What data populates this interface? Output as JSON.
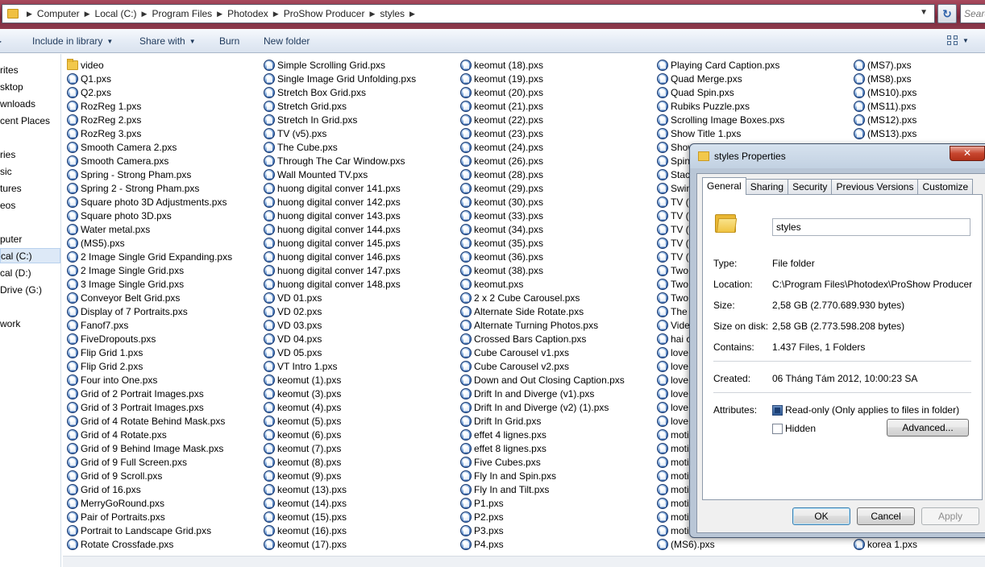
{
  "address": {
    "crumbs": [
      "Computer",
      "Local (C:)",
      "Program Files",
      "Photodex",
      "ProShow Producer",
      "styles"
    ],
    "search_placeholder": "Search styles"
  },
  "toolbar": {
    "include_label": "Include in library",
    "share_label": "Share with",
    "burn_label": "Burn",
    "new_folder_label": "New folder"
  },
  "nav": {
    "items": [
      "rites",
      "sktop",
      "wnloads",
      "cent Places",
      "ries",
      "sic",
      "tures",
      "eos",
      "puter",
      "cal (C:)",
      "cal (D:)",
      " Drive (G:)",
      "work"
    ],
    "selected_index": 9
  },
  "files": {
    "col1": [
      {
        "name": "video",
        "icon": "folder-icon"
      },
      {
        "name": "Q1.pxs",
        "icon": "pxs-icon"
      },
      {
        "name": "Q2.pxs",
        "icon": "pxs-icon"
      },
      {
        "name": "RozReg 1.pxs",
        "icon": "pxs-icon"
      },
      {
        "name": "RozReg 2.pxs",
        "icon": "pxs-icon"
      },
      {
        "name": "RozReg 3.pxs",
        "icon": "pxs-icon"
      },
      {
        "name": "Smooth Camera 2.pxs",
        "icon": "pxs-icon"
      },
      {
        "name": "Smooth Camera.pxs",
        "icon": "pxs-icon"
      },
      {
        "name": "Spring - Strong Pham.pxs",
        "icon": "pxs-icon"
      },
      {
        "name": "Spring 2 - Strong Pham.pxs",
        "icon": "pxs-icon"
      },
      {
        "name": "Square photo 3D Adjustments.pxs",
        "icon": "pxs-icon"
      },
      {
        "name": "Square photo 3D.pxs",
        "icon": "pxs-icon"
      },
      {
        "name": "Water metal.pxs",
        "icon": "pxs-icon"
      },
      {
        "name": "(MS5).pxs",
        "icon": "pxs-icon"
      },
      {
        "name": "2 Image Single Grid Expanding.pxs",
        "icon": "pxs-icon"
      },
      {
        "name": "2 Image Single Grid.pxs",
        "icon": "pxs-icon"
      },
      {
        "name": "3 Image Single Grid.pxs",
        "icon": "pxs-icon"
      },
      {
        "name": "Conveyor Belt Grid.pxs",
        "icon": "pxs-icon"
      },
      {
        "name": "Display of 7 Portraits.pxs",
        "icon": "pxs-icon"
      },
      {
        "name": "Fanof7.pxs",
        "icon": "pxs-icon"
      },
      {
        "name": "FiveDropouts.pxs",
        "icon": "pxs-icon"
      },
      {
        "name": "Flip Grid 1.pxs",
        "icon": "pxs-icon"
      },
      {
        "name": "Flip Grid 2.pxs",
        "icon": "pxs-icon"
      },
      {
        "name": "Four into One.pxs",
        "icon": "pxs-icon"
      },
      {
        "name": "Grid of 2 Portrait Images.pxs",
        "icon": "pxs-icon"
      },
      {
        "name": "Grid of 3 Portrait Images.pxs",
        "icon": "pxs-icon"
      },
      {
        "name": "Grid of 4 Rotate Behind Mask.pxs",
        "icon": "pxs-icon"
      },
      {
        "name": "Grid of 4 Rotate.pxs",
        "icon": "pxs-icon"
      },
      {
        "name": "Grid of 9 Behind Image Mask.pxs",
        "icon": "pxs-icon"
      },
      {
        "name": "Grid of 9 Full Screen.pxs",
        "icon": "pxs-icon"
      },
      {
        "name": "Grid of 9 Scroll.pxs",
        "icon": "pxs-icon"
      },
      {
        "name": "Grid of 16.pxs",
        "icon": "pxs-icon"
      },
      {
        "name": "MerryGoRound.pxs",
        "icon": "pxs-icon"
      },
      {
        "name": "Pair of Portraits.pxs",
        "icon": "pxs-icon"
      },
      {
        "name": "Portrait to Landscape Grid.pxs",
        "icon": "pxs-icon"
      },
      {
        "name": "Rotate Crossfade.pxs",
        "icon": "pxs-icon"
      }
    ],
    "col2": [
      "Simple Scrolling Grid.pxs",
      "Single Image Grid Unfolding.pxs",
      "Stretch Box Grid.pxs",
      "Stretch Grid.pxs",
      "Stretch In Grid.pxs",
      "TV (v5).pxs",
      "The Cube.pxs",
      "Through The Car Window.pxs",
      "Wall Mounted TV.pxs",
      "huong digital conver 141.pxs",
      "huong digital conver 142.pxs",
      "huong digital conver 143.pxs",
      "huong digital conver 144.pxs",
      "huong digital conver 145.pxs",
      "huong digital conver 146.pxs",
      "huong digital conver 147.pxs",
      "huong digital conver 148.pxs",
      "VD 01.pxs",
      "VD 02.pxs",
      "VD 03.pxs",
      "VD 04.pxs",
      "VD 05.pxs",
      "VT Intro 1.pxs",
      "keomut (1).pxs",
      "keomut (3).pxs",
      "keomut (4).pxs",
      "keomut (5).pxs",
      "keomut (6).pxs",
      "keomut (7).pxs",
      "keomut (8).pxs",
      "keomut (9).pxs",
      "keomut (13).pxs",
      "keomut (14).pxs",
      "keomut (15).pxs",
      "keomut (16).pxs",
      "keomut (17).pxs"
    ],
    "col3": [
      "keomut (18).pxs",
      "keomut (19).pxs",
      "keomut (20).pxs",
      "keomut (21).pxs",
      "keomut (22).pxs",
      "keomut (23).pxs",
      "keomut (24).pxs",
      "keomut (26).pxs",
      "keomut (28).pxs",
      "keomut (29).pxs",
      "keomut (30).pxs",
      "keomut (33).pxs",
      "keomut (34).pxs",
      "keomut (35).pxs",
      "keomut (36).pxs",
      "keomut (38).pxs",
      "keomut.pxs",
      "2 x 2 Cube Carousel.pxs",
      "Alternate Side Rotate.pxs",
      "Alternate Turning Photos.pxs",
      "Crossed Bars Caption.pxs",
      "Cube Carousel v1.pxs",
      "Cube Carousel v2.pxs",
      "Down and Out Closing Caption.pxs",
      "Drift In and Diverge (v1).pxs",
      "Drift In and Diverge (v2) (1).pxs",
      "Drift In Grid.pxs",
      "effet 4 lignes.pxs",
      "effet 8 lignes.pxs",
      "Five Cubes.pxs",
      "Fly In and Spin.pxs",
      "Fly In and Tilt.pxs",
      "P1.pxs",
      "P2.pxs",
      "P3.pxs",
      "P4.pxs"
    ],
    "col4": [
      "Playing Card Caption.pxs",
      "Quad Merge.pxs",
      "Quad Spin.pxs",
      "Rubiks Puzzle.pxs",
      "Scrolling Image Boxes.pxs",
      "Show Title 1.pxs",
      "Show",
      "Spin",
      "Stac",
      "Swin",
      "TV (v",
      "TV (v",
      "TV (v",
      "TV (v",
      "TV (v",
      "Two",
      "Two",
      "Two",
      "The",
      "Vide",
      "hai c",
      "love",
      "love",
      "love",
      "love",
      "love",
      "love",
      "moti",
      "moti",
      "moti",
      "moti",
      "moti",
      "moti",
      "moti",
      "moti",
      "(MS6).pxs"
    ],
    "col5": [
      "(MS7).pxs",
      "(MS8).pxs",
      "(MS10).pxs",
      "(MS11).pxs",
      "(MS12).pxs",
      "(MS13).pxs"
    ],
    "col5_last": "korea 1.pxs"
  },
  "dialog": {
    "title": "styles Properties",
    "close_label": "✕",
    "tabs": [
      "General",
      "Sharing",
      "Security",
      "Previous Versions",
      "Customize"
    ],
    "active_tab": "General",
    "name_value": "styles",
    "type_label": "Type:",
    "type_value": "File folder",
    "location_label": "Location:",
    "location_value": "C:\\Program Files\\Photodex\\ProShow Producer",
    "size_label": "Size:",
    "size_value": "2,58 GB (2.770.689.930 bytes)",
    "size_on_disk_label": "Size on disk:",
    "size_on_disk_value": "2,58 GB (2.773.598.208 bytes)",
    "contains_label": "Contains:",
    "contains_value": "1.437 Files, 1 Folders",
    "created_label": "Created:",
    "created_value": "06 Tháng Tám 2012, 10:00:23 SA",
    "attributes_label": "Attributes:",
    "readonly_label": "Read-only (Only applies to files in folder)",
    "readonly_checked": true,
    "hidden_label": "Hidden",
    "hidden_checked": false,
    "advanced_label": "Advanced...",
    "ok_label": "OK",
    "cancel_label": "Cancel",
    "apply_label": "Apply"
  }
}
